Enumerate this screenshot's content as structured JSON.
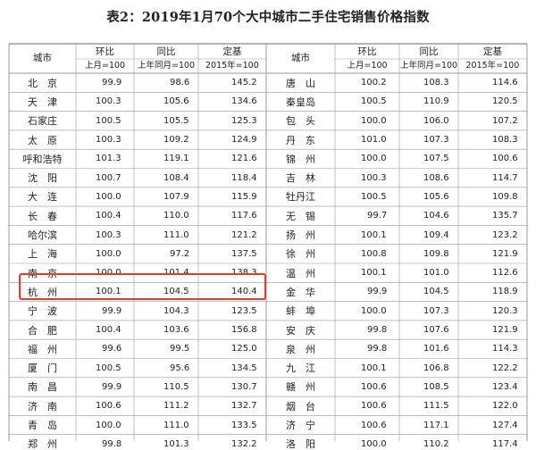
{
  "title": "表2：2019年1月70个大中城市二手住宅销售价格指数",
  "headers": {
    "city": "城市",
    "mom": "环比",
    "mom_base": "上月=100",
    "yoy": "同比",
    "yoy_base": "上年同月=100",
    "fixed": "定基",
    "fixed_base": "2015年=100"
  },
  "rows": [
    {
      "left": {
        "city": "北　京",
        "mom": "99.9",
        "yoy": "98.6",
        "fixed": "145.2"
      },
      "right": {
        "city": "唐　山",
        "mom": "100.2",
        "yoy": "108.3",
        "fixed": "114.6"
      }
    },
    {
      "left": {
        "city": "天　津",
        "mom": "100.3",
        "yoy": "105.6",
        "fixed": "134.6"
      },
      "right": {
        "city": "秦皇岛",
        "mom": "100.5",
        "yoy": "110.9",
        "fixed": "120.5"
      }
    },
    {
      "left": {
        "city": "石家庄",
        "mom": "100.5",
        "yoy": "105.5",
        "fixed": "125.3"
      },
      "right": {
        "city": "包　头",
        "mom": "100.0",
        "yoy": "106.0",
        "fixed": "107.2"
      }
    },
    {
      "left": {
        "city": "太　原",
        "mom": "100.3",
        "yoy": "109.2",
        "fixed": "124.9"
      },
      "right": {
        "city": "丹　东",
        "mom": "101.0",
        "yoy": "107.3",
        "fixed": "108.3"
      }
    },
    {
      "left": {
        "city": "呼和浩特",
        "mom": "101.3",
        "yoy": "119.1",
        "fixed": "121.6"
      },
      "right": {
        "city": "锦　州",
        "mom": "100.0",
        "yoy": "107.5",
        "fixed": "100.6"
      }
    },
    {
      "left": {
        "city": "沈　阳",
        "mom": "100.7",
        "yoy": "108.4",
        "fixed": "118.4"
      },
      "right": {
        "city": "吉　林",
        "mom": "100.3",
        "yoy": "108.6",
        "fixed": "114.7"
      }
    },
    {
      "left": {
        "city": "大　连",
        "mom": "100.0",
        "yoy": "107.9",
        "fixed": "115.9"
      },
      "right": {
        "city": "牡丹江",
        "mom": "100.5",
        "yoy": "105.6",
        "fixed": "109.8"
      }
    },
    {
      "left": {
        "city": "长　春",
        "mom": "100.4",
        "yoy": "110.0",
        "fixed": "117.6"
      },
      "right": {
        "city": "无　锡",
        "mom": "99.7",
        "yoy": "104.6",
        "fixed": "135.7"
      }
    },
    {
      "left": {
        "city": "哈尔滨",
        "mom": "100.3",
        "yoy": "111.0",
        "fixed": "121.2"
      },
      "right": {
        "city": "扬　州",
        "mom": "100.1",
        "yoy": "109.4",
        "fixed": "123.2"
      }
    },
    {
      "left": {
        "city": "上　海",
        "mom": "100.0",
        "yoy": "97.2",
        "fixed": "137.5"
      },
      "right": {
        "city": "徐　州",
        "mom": "100.8",
        "yoy": "109.8",
        "fixed": "121.9"
      }
    },
    {
      "left": {
        "city": "南　京",
        "mom": "100.0",
        "yoy": "101.4",
        "fixed": "138.3"
      },
      "right": {
        "city": "温　州",
        "mom": "100.1",
        "yoy": "101.0",
        "fixed": "112.6"
      }
    },
    {
      "left": {
        "city": "杭　州",
        "mom": "100.1",
        "yoy": "104.5",
        "fixed": "140.4"
      },
      "right": {
        "city": "金　华",
        "mom": "99.9",
        "yoy": "104.5",
        "fixed": "118.9"
      }
    },
    {
      "left": {
        "city": "宁　波",
        "mom": "99.9",
        "yoy": "104.3",
        "fixed": "123.5"
      },
      "right": {
        "city": "蚌　埠",
        "mom": "100.0",
        "yoy": "107.3",
        "fixed": "120.3"
      }
    },
    {
      "left": {
        "city": "合　肥",
        "mom": "100.4",
        "yoy": "103.6",
        "fixed": "156.8"
      },
      "right": {
        "city": "安　庆",
        "mom": "99.8",
        "yoy": "107.6",
        "fixed": "121.9"
      }
    },
    {
      "left": {
        "city": "福　州",
        "mom": "99.6",
        "yoy": "99.5",
        "fixed": "125.0"
      },
      "right": {
        "city": "泉　州",
        "mom": "99.8",
        "yoy": "101.6",
        "fixed": "114.3"
      }
    },
    {
      "left": {
        "city": "厦　门",
        "mom": "100.5",
        "yoy": "95.6",
        "fixed": "134.5"
      },
      "right": {
        "city": "九　江",
        "mom": "100.1",
        "yoy": "106.8",
        "fixed": "122.2"
      }
    },
    {
      "left": {
        "city": "南　昌",
        "mom": "99.9",
        "yoy": "110.5",
        "fixed": "130.7"
      },
      "right": {
        "city": "赣　州",
        "mom": "100.6",
        "yoy": "108.5",
        "fixed": "123.4"
      }
    },
    {
      "left": {
        "city": "济　南",
        "mom": "100.6",
        "yoy": "111.2",
        "fixed": "132.7"
      },
      "right": {
        "city": "烟　台",
        "mom": "100.6",
        "yoy": "111.5",
        "fixed": "122.0"
      }
    },
    {
      "left": {
        "city": "青　岛",
        "mom": "100.0",
        "yoy": "111.0",
        "fixed": "133.5"
      },
      "right": {
        "city": "济　宁",
        "mom": "100.6",
        "yoy": "117.1",
        "fixed": "127.4"
      }
    },
    {
      "left": {
        "city": "郑　州",
        "mom": "99.8",
        "yoy": "101.3",
        "fixed": "132.2"
      },
      "right": {
        "city": "洛　阳",
        "mom": "100.0",
        "yoy": "110.2",
        "fixed": "117.4"
      }
    }
  ],
  "highlight": {
    "row": 11,
    "side": "left",
    "color": "#e53b2f"
  },
  "colors": {
    "grid": "#9a9a9a",
    "text": "#222222",
    "highlight": "#e53b2f"
  }
}
